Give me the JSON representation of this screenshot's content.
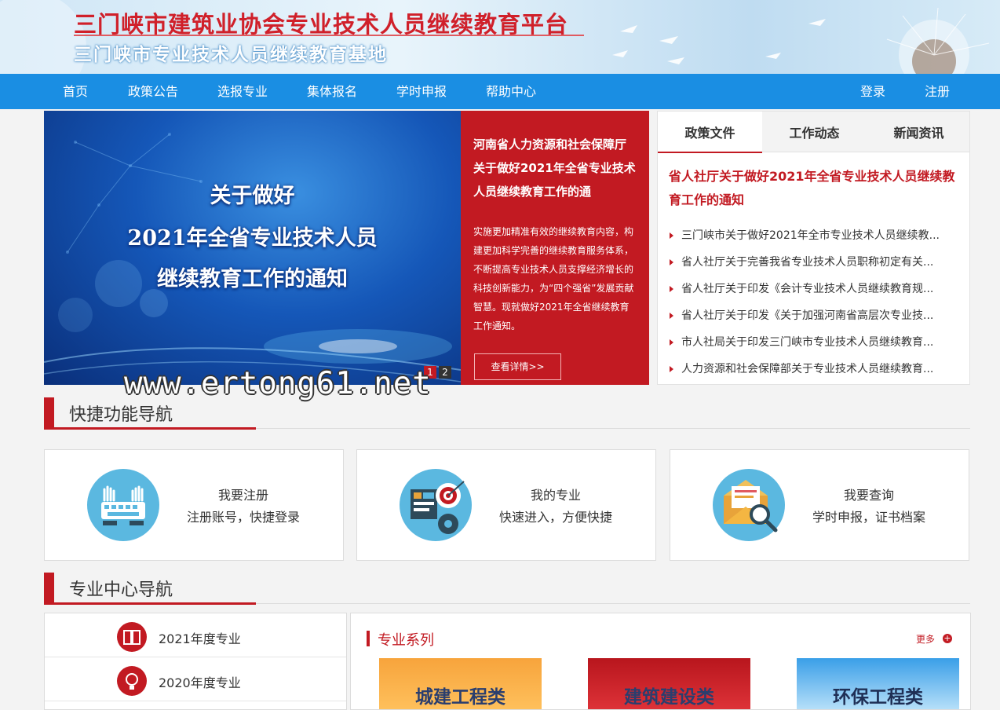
{
  "header": {
    "title": "三门峡市建筑业协会专业技术人员继续教育平台",
    "subtitle": "三门峡市专业技术人员继续教育基地"
  },
  "nav": {
    "items": [
      "首页",
      "政策公告",
      "选报专业",
      "集体报名",
      "学时申报",
      "帮助中心"
    ],
    "login": "登录",
    "register": "注册"
  },
  "slider": {
    "caption_lines": [
      "关于做好",
      "2021年全省专业技术人员",
      "继续教育工作的通知"
    ],
    "dots": [
      "1",
      "2"
    ],
    "title": "河南省人力资源和社会保障厅 关于做好2021年全省专业技术人员继续教育工作的通",
    "description": "实施更加精准有效的继续教育内容，构建更加科学完善的继续教育服务体系，不断提高专业技术人员支撑经济增长的科技创新能力，为“四个强省”发展贡献智慧。现就做好2021年全省继续教育工作通知。",
    "more": "查看详情>>"
  },
  "news": {
    "tabs": [
      "政策文件",
      "工作动态",
      "新闻资讯"
    ],
    "headline": "省人社厅关于做好2021年全省专业技术人员继续教育工作的通知",
    "items": [
      "三门峡市关于做好2021年全市专业技术人员继续教...",
      "省人社厅关于完善我省专业技术人员职称初定有关...",
      "省人社厅关于印发《会计专业技术人员继续教育规...",
      "省人社厅关于印发《关于加强河南省高层次专业技...",
      "市人社局关于印发三门峡市专业技术人员继续教育...",
      "人力资源和社会保障部关于专业技术人员继续教育..."
    ]
  },
  "quick_nav": {
    "heading": "快捷功能导航",
    "cards": [
      {
        "label": "我要注册",
        "sub": "注册账号，快捷登录"
      },
      {
        "label": "我的专业",
        "sub": "快速进入，方便快捷"
      },
      {
        "label": "我要查询",
        "sub": "学时申报，证书档案"
      }
    ]
  },
  "center_nav": {
    "heading": "专业中心导航",
    "years": [
      "2021年度专业",
      "2020年度专业"
    ],
    "series_title": "专业系列",
    "more": "更多",
    "tiles": [
      "城建工程类",
      "建筑建设类",
      "环保工程类"
    ]
  },
  "watermark": "www.ertong61.net",
  "colors": {
    "nav_blue": "#1a8ee3",
    "brand_red": "#c21a22"
  }
}
